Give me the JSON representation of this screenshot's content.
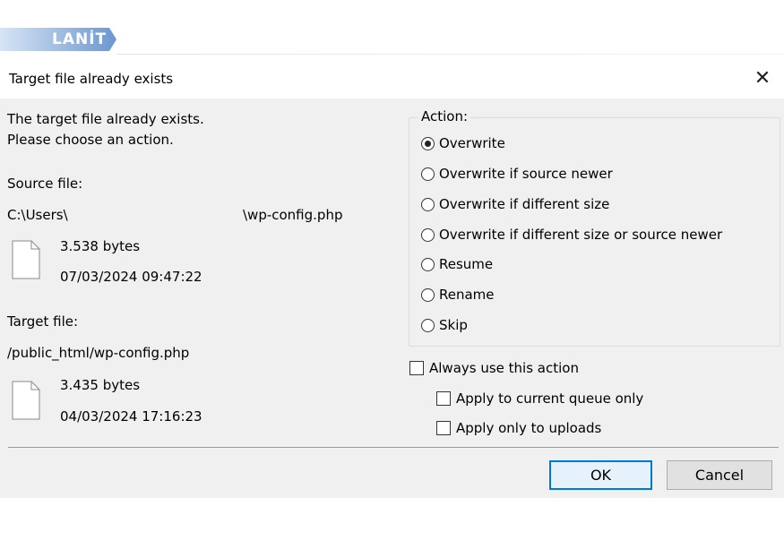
{
  "brand": {
    "text": "LANİT"
  },
  "dialog": {
    "title": "Target file already exists",
    "close_glyph": "✕",
    "intro_line1": "The target file already exists.",
    "intro_line2": "Please choose an action.",
    "source": {
      "label": "Source file:",
      "path_start": "C:\\Users\\",
      "path_end": "\\wp-config.php",
      "size": "3.538 bytes",
      "date": "07/03/2024 09:47:22"
    },
    "target": {
      "label": "Target file:",
      "path": "/public_html/wp-config.php",
      "size": "3.435 bytes",
      "date": "04/03/2024 17:16:23"
    },
    "action": {
      "label": "Action:",
      "options": [
        {
          "label": "Overwrite",
          "selected": true
        },
        {
          "label": "Overwrite if source newer",
          "selected": false
        },
        {
          "label": "Overwrite if different size",
          "selected": false
        },
        {
          "label": "Overwrite if different size or source newer",
          "selected": false
        },
        {
          "label": "Resume",
          "selected": false
        },
        {
          "label": "Rename",
          "selected": false
        },
        {
          "label": "Skip",
          "selected": false
        }
      ]
    },
    "checkboxes": {
      "always_use": {
        "label": "Always use this action",
        "checked": false
      },
      "current_queue": {
        "label": "Apply to current queue only",
        "checked": false
      },
      "only_uploads": {
        "label": "Apply only to uploads",
        "checked": false
      }
    },
    "buttons": {
      "ok": "OK",
      "cancel": "Cancel"
    },
    "colors": {
      "body_bg": "#f0f0f0",
      "default_button_border": "#0078d7"
    }
  }
}
